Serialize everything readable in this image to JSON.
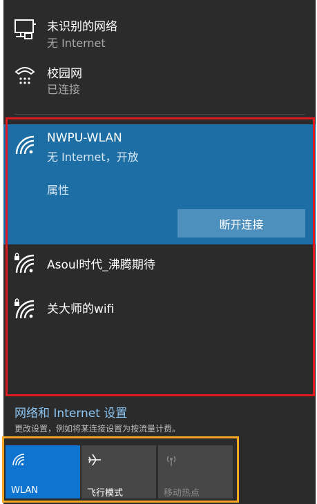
{
  "colors": {
    "panel_background": "#2b2b2b",
    "selected_network_background": "#1c6ea4",
    "accent_tile": "#0f74cf",
    "link_text": "#8cc5f2",
    "highlight_red": "#e0191e",
    "highlight_orange": "#f5a623"
  },
  "connections": [
    {
      "name": "未识别的网络",
      "status": "无 Internet",
      "icon": "ethernet-icon"
    },
    {
      "name": "校园网",
      "status": "已连接",
      "icon": "dialup-icon"
    }
  ],
  "wifi_selected": {
    "name": "NWPU-WLAN",
    "status": "无 Internet，开放",
    "properties_label": "属性",
    "disconnect_label": "断开连接",
    "icon": "wifi-icon"
  },
  "wifi_networks": [
    {
      "name": "Asoul时代_沸腾期待",
      "icon": "wifi-secured-icon"
    },
    {
      "name": "关大师的wifi",
      "icon": "wifi-secured-icon"
    }
  ],
  "settings": {
    "link_label": "网络和 Internet 设置",
    "description": "更改设置，例如将某连接设置为按流量计费。"
  },
  "quick_actions": [
    {
      "label": "WLAN",
      "icon": "wifi-icon",
      "active": true
    },
    {
      "label": "飞行模式",
      "icon": "airplane-icon",
      "active": false
    },
    {
      "label": "移动热点",
      "icon": "hotspot-icon",
      "active": false,
      "disabled": true
    }
  ]
}
